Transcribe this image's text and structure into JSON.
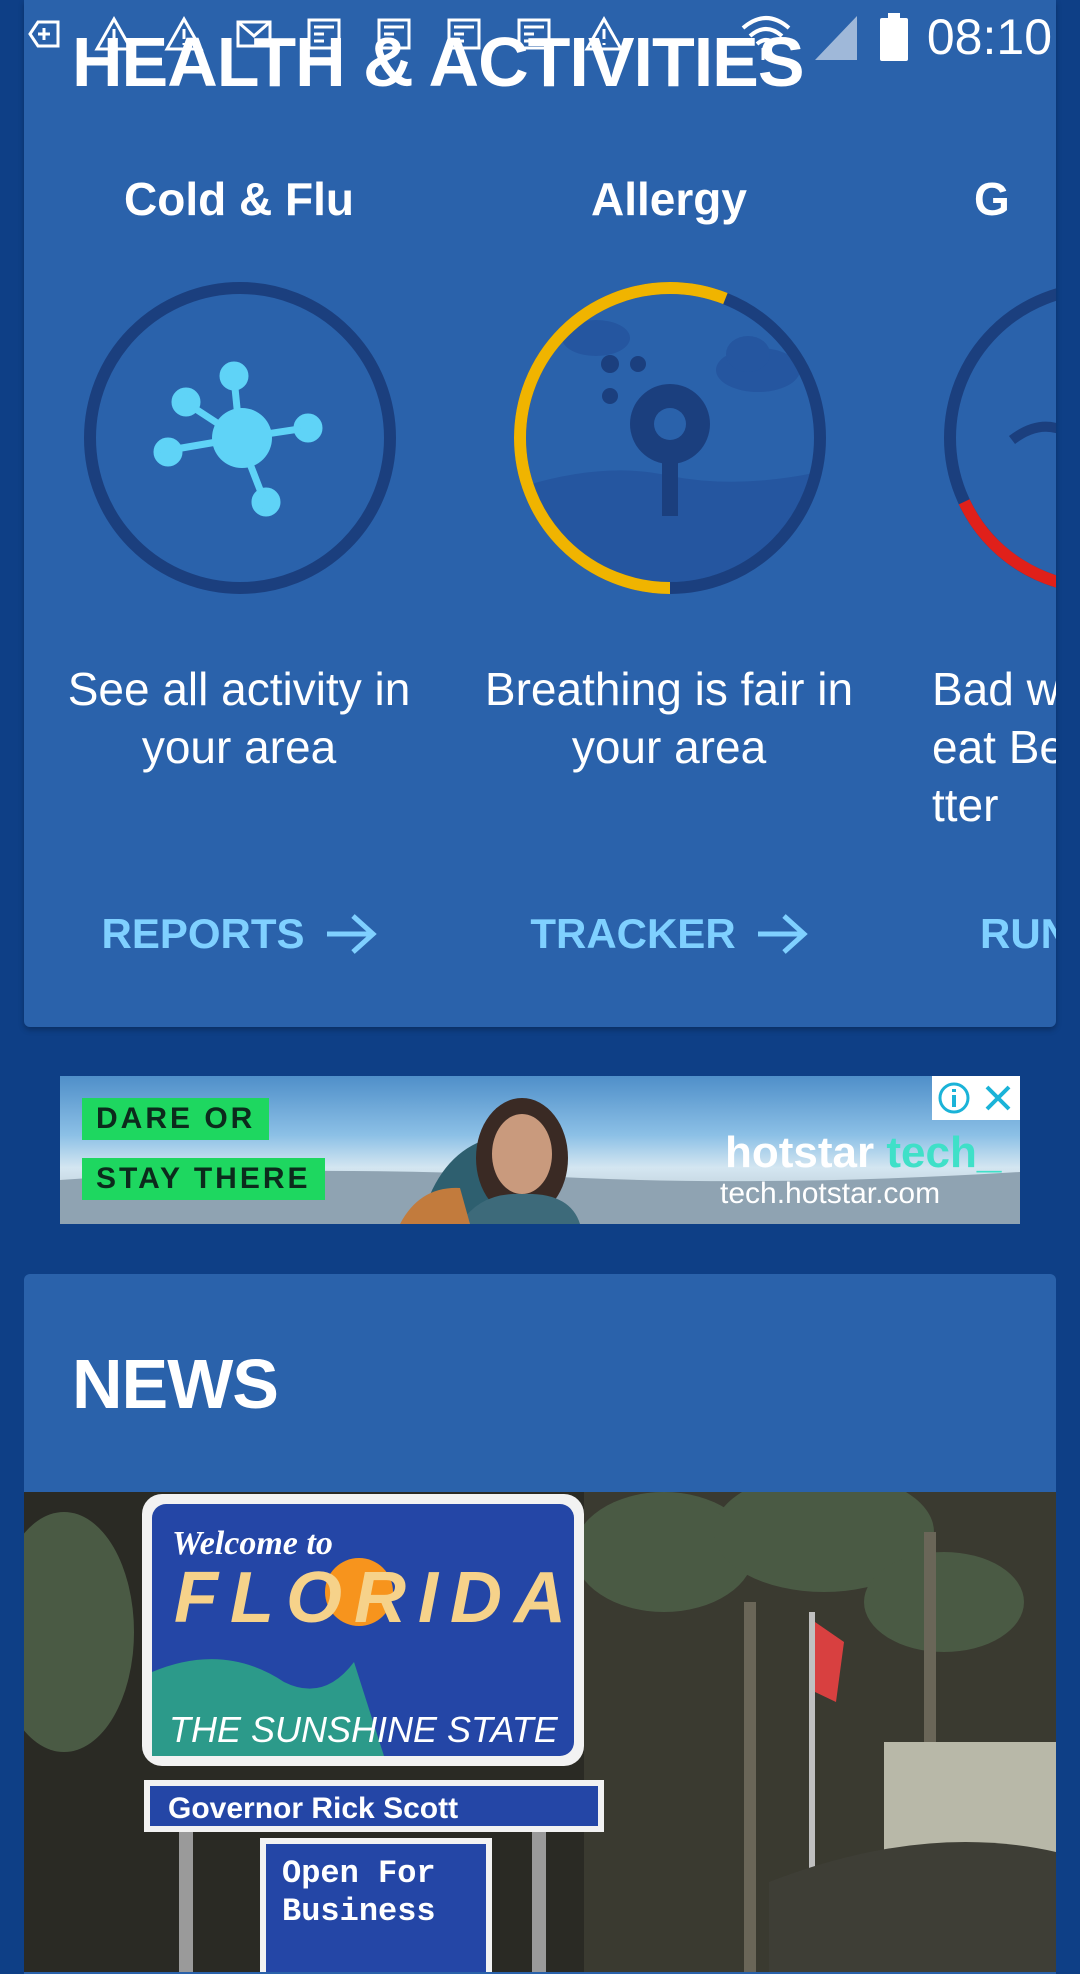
{
  "status_bar": {
    "time": "08:10",
    "left_icons": [
      "add-icon",
      "warning-icon",
      "warning-icon",
      "gmail-icon",
      "news-icon",
      "news-icon",
      "news-icon",
      "news-icon",
      "warning-icon"
    ],
    "right_icons": [
      "wifi-icon",
      "signal-icon",
      "battery-icon"
    ]
  },
  "health": {
    "title": "HEALTH & ACTIVITIES",
    "tiles": [
      {
        "title": "Cold & Flu",
        "description": "See all activity in your area",
        "link": "REPORTS",
        "icon": "virus-icon"
      },
      {
        "title": "Allergy",
        "description": "Breathing is fair in your area",
        "link": "TRACKER",
        "icon": "allergy-icon",
        "level_fraction": 0.56
      },
      {
        "title": "G",
        "description": "Bad weat Better",
        "link": "RUN T",
        "icon": "run-icon",
        "level_fraction": 0.18
      }
    ]
  },
  "ad": {
    "tag_line_1": "DARE OR",
    "tag_line_2": "STAY THERE",
    "brand": "hotstar",
    "brand_suffix": "tech_",
    "url": "tech.hotstar.com"
  },
  "news": {
    "title": "NEWS",
    "sign_welcome": "Welcome to",
    "sign_state": "FLORIDA",
    "sign_tagline": "THE SUNSHINE STATE",
    "sign_governor": "Governor Rick Scott",
    "sign_open_1": "Open For",
    "sign_open_2": "Business"
  },
  "colors": {
    "background": "#0e3f86",
    "card": "#2a62ab",
    "ring_track": "#1b3f7e",
    "ring_allergy": "#f0b400",
    "ring_run": "#e0201a",
    "link": "#7fd0ff",
    "virus": "#5fd3f7"
  }
}
